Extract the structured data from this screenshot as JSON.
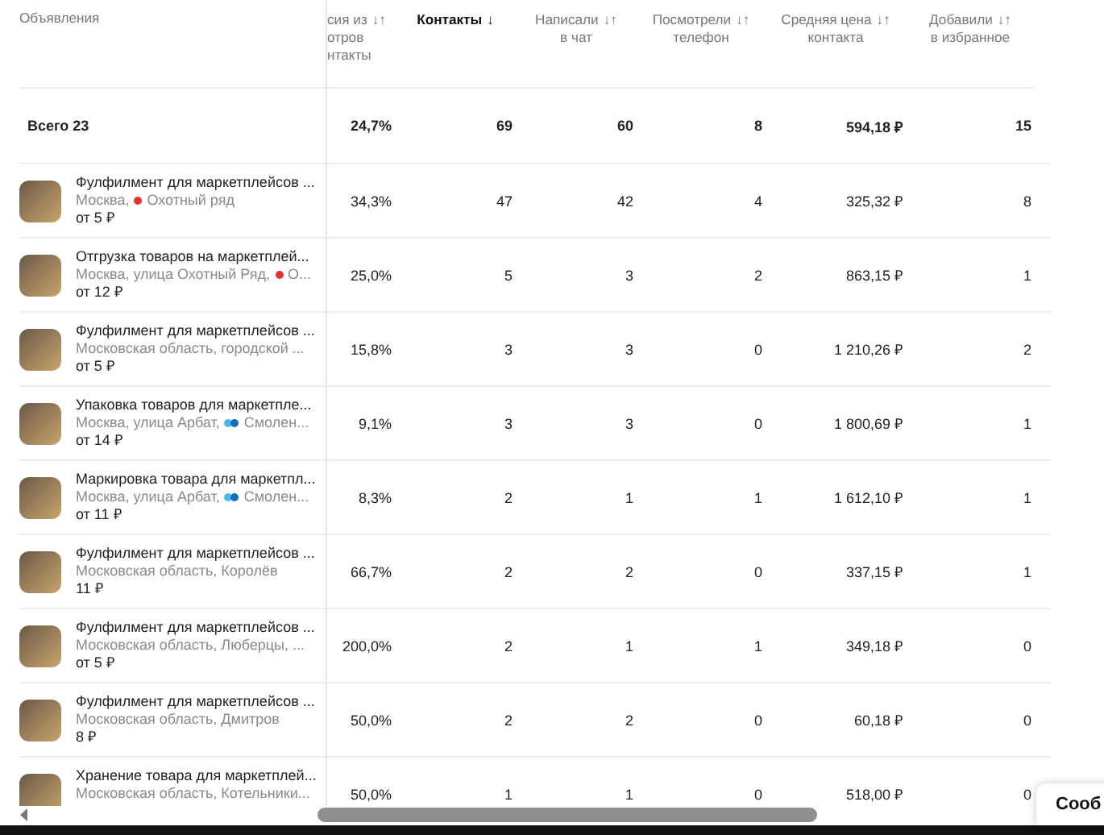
{
  "table": {
    "ad_column_label": "Объявления",
    "columns": [
      {
        "lines": [
          "сия из",
          "отров",
          "нтакты"
        ],
        "sort_glyph": "↓↑",
        "sorted": false
      },
      {
        "lines": [
          "Контакты"
        ],
        "sort_glyph": "↓",
        "sorted": true
      },
      {
        "lines": [
          "Написали",
          "в чат"
        ],
        "sort_glyph": "↓↑",
        "sorted": false
      },
      {
        "lines": [
          "Посмотрели",
          "телефон"
        ],
        "sort_glyph": "↓↑",
        "sorted": false
      },
      {
        "lines": [
          "Средняя цена",
          "контакта"
        ],
        "sort_glyph": "↓↑",
        "sorted": false
      },
      {
        "lines": [
          "Добавили",
          "в избранное"
        ],
        "sort_glyph": "↓↑",
        "sorted": false
      }
    ],
    "total": {
      "label": "Всего 23",
      "values": [
        "24,7%",
        "69",
        "60",
        "8",
        "594,18 ₽",
        "15"
      ]
    },
    "rows": [
      {
        "title": "Фулфилмент для маркетплейсов ...",
        "location": [
          {
            "kind": "text",
            "text": "Москва,"
          },
          {
            "kind": "metro",
            "color": "#e3342f"
          },
          {
            "kind": "text",
            "text": "Охотный ряд"
          }
        ],
        "price": "от 5 ₽",
        "values": [
          "34,3%",
          "47",
          "42",
          "4",
          "325,32 ₽",
          "8"
        ]
      },
      {
        "title": "Отгрузка товаров на маркетплей...",
        "location": [
          {
            "kind": "text",
            "text": "Москва, улица Охотный Ряд,"
          },
          {
            "kind": "metro",
            "color": "#e3342f"
          },
          {
            "kind": "text",
            "text": "О..."
          }
        ],
        "price": "от 12 ₽",
        "values": [
          "25,0%",
          "5",
          "3",
          "2",
          "863,15 ₽",
          "1"
        ]
      },
      {
        "title": "Фулфилмент для маркетплейсов ...",
        "location": [
          {
            "kind": "text",
            "text": "Московская область, городской ..."
          }
        ],
        "price": "от 5 ₽",
        "values": [
          "15,8%",
          "3",
          "3",
          "0",
          "1 210,26 ₽",
          "2"
        ]
      },
      {
        "title": "Упаковка товаров для маркетпле...",
        "location": [
          {
            "kind": "text",
            "text": "Москва, улица Арбат,"
          },
          {
            "kind": "metro",
            "color": "#4fb8e6"
          },
          {
            "kind": "metro",
            "color": "#0a6fc2"
          },
          {
            "kind": "text",
            "text": "Смолен..."
          }
        ],
        "price": "от 14 ₽",
        "values": [
          "9,1%",
          "3",
          "3",
          "0",
          "1 800,69 ₽",
          "1"
        ]
      },
      {
        "title": "Маркировка товара для маркетпл...",
        "location": [
          {
            "kind": "text",
            "text": "Москва, улица Арбат,"
          },
          {
            "kind": "metro",
            "color": "#4fb8e6"
          },
          {
            "kind": "metro",
            "color": "#0a6fc2"
          },
          {
            "kind": "text",
            "text": "Смолен..."
          }
        ],
        "price": "от 11 ₽",
        "values": [
          "8,3%",
          "2",
          "1",
          "1",
          "1 612,10 ₽",
          "1"
        ]
      },
      {
        "title": "Фулфилмент для маркетплейсов ...",
        "location": [
          {
            "kind": "text",
            "text": "Московская область, Королёв"
          }
        ],
        "price": "11 ₽",
        "values": [
          "66,7%",
          "2",
          "2",
          "0",
          "337,15 ₽",
          "1"
        ]
      },
      {
        "title": "Фулфилмент для маркетплейсов ...",
        "location": [
          {
            "kind": "text",
            "text": "Московская область, Люберцы, ..."
          }
        ],
        "price": "от 5 ₽",
        "values": [
          "200,0%",
          "2",
          "1",
          "1",
          "349,18 ₽",
          "0"
        ]
      },
      {
        "title": "Фулфилмент для маркетплейсов ...",
        "location": [
          {
            "kind": "text",
            "text": "Московская область, Дмитров"
          }
        ],
        "price": "8 ₽",
        "values": [
          "50,0%",
          "2",
          "2",
          "0",
          "60,18 ₽",
          "0"
        ]
      },
      {
        "title": "Хранение товара для маркетплей...",
        "location": [
          {
            "kind": "text",
            "text": "Московская область, Котельники..."
          }
        ],
        "values": [
          "50,0%",
          "1",
          "1",
          "0",
          "518,00 ₽",
          "0"
        ]
      }
    ]
  },
  "chat_button": {
    "label": "Сооб"
  }
}
